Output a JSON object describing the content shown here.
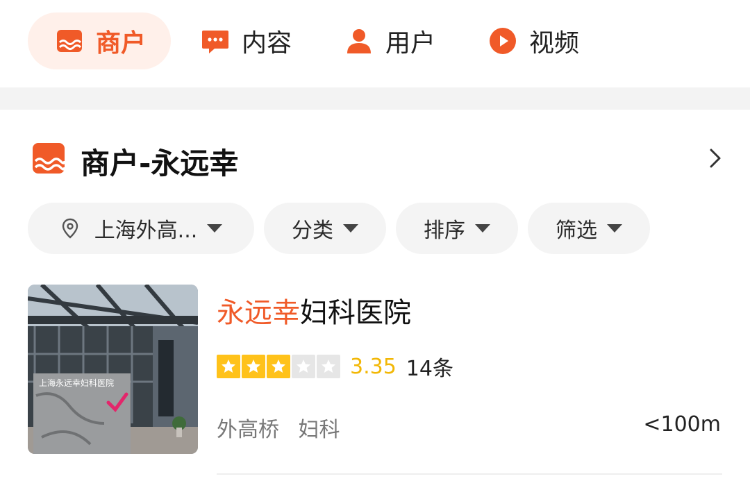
{
  "colors": {
    "accent": "#f05a28",
    "accent_bg": "#fff0ea",
    "star": "#ffc21a",
    "score": "#f2b705"
  },
  "tabs": [
    {
      "label": "商户",
      "icon": "shop-icon",
      "active": true
    },
    {
      "label": "内容",
      "icon": "comment-icon",
      "active": false
    },
    {
      "label": "用户",
      "icon": "user-icon",
      "active": false
    },
    {
      "label": "视频",
      "icon": "play-icon",
      "active": false
    }
  ],
  "section": {
    "title": "商户-永远幸",
    "icon": "shop-icon",
    "more_icon": "chevron-right-icon"
  },
  "filters": [
    {
      "label": "上海外高...",
      "icon": "location-pin-icon"
    },
    {
      "label": "分类"
    },
    {
      "label": "排序"
    },
    {
      "label": "筛选"
    }
  ],
  "result": {
    "name_highlight": "永远幸",
    "name_rest": "妇科医院",
    "rating": 3,
    "rating_max": 5,
    "score": "3.35",
    "review_count": "14条",
    "tags": [
      "外高桥",
      "妇科"
    ],
    "distance": "<100m",
    "image_sign_text": "上海永远幸妇科医院"
  }
}
